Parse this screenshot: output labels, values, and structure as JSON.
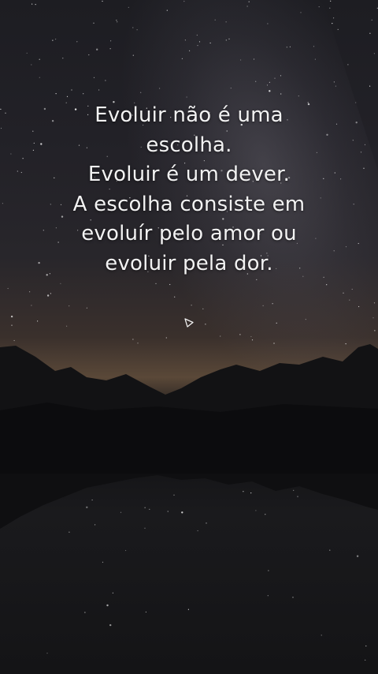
{
  "quote": {
    "lines": [
      "Evoluir não é uma",
      "escolha.",
      "Evoluir é um dever.",
      "A escolha consiste em",
      "evoluír pelo amor ou",
      "evoluir pela dor."
    ]
  },
  "icons": {
    "play_indicator": "play-triangle-outline-icon"
  },
  "colors": {
    "text": "#f2f2f2",
    "sky": "#222127",
    "horizon_glow": "#5a4838",
    "water": "#141416"
  }
}
